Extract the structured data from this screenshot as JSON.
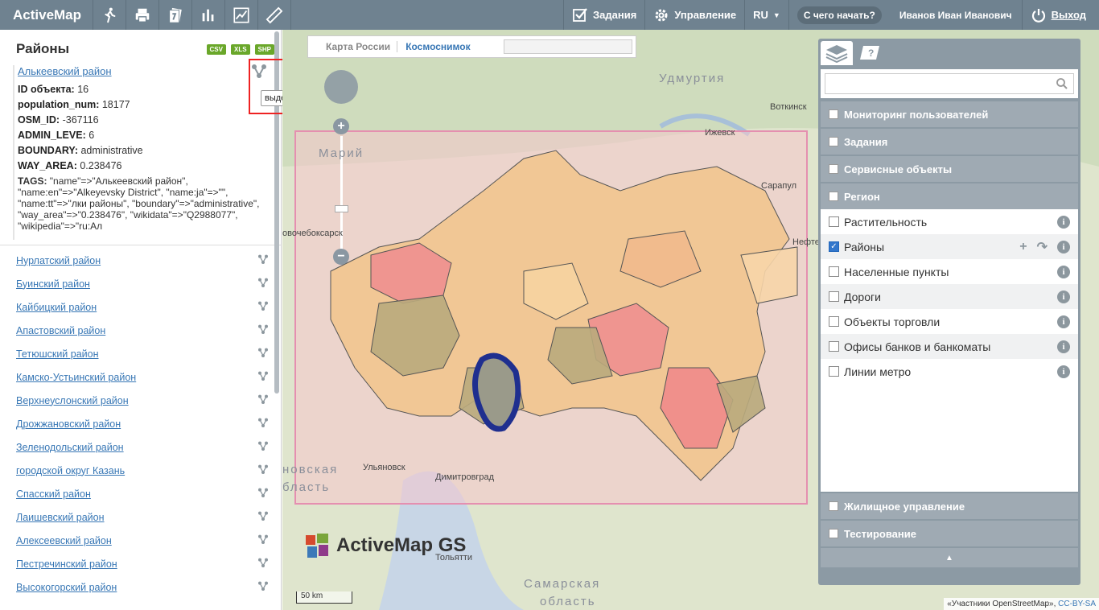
{
  "app": {
    "title": "ActiveMap"
  },
  "toolbar": {
    "icons": [
      "walk-icon",
      "print-icon",
      "document-icon",
      "bar-chart-icon",
      "line-chart-icon",
      "ruler-icon"
    ],
    "tasks_label": "Задания",
    "manage_label": "Управление",
    "lang_label": "RU",
    "help_label": "С чего начать?",
    "user_name": "Иванов Иван Иванович",
    "logout_label": "Выход"
  },
  "left": {
    "title": "Районы",
    "exports": [
      "CSV",
      "XLS",
      "SHP"
    ],
    "selected": {
      "name": "Алькеевский район",
      "fields": [
        {
          "k": "ID объекта:",
          "v": "16"
        },
        {
          "k": "population_num:",
          "v": "18177"
        },
        {
          "k": "OSM_ID:",
          "v": "-367116"
        },
        {
          "k": "ADMIN_LEVE:",
          "v": "6"
        },
        {
          "k": "BOUNDARY:",
          "v": "administrative"
        },
        {
          "k": "WAY_AREA:",
          "v": "0.238476"
        }
      ],
      "tags_label": "TAGS:",
      "tags": "\"name\"=>\"Алькеевский район\", \"name:en\"=>\"Alkeyevsky District\", \"name:ja\"=>\"\", \"name:tt\"=>\"лки районы\", \"boundary\"=>\"administrative\", \"way_area\"=>\"0.238476\", \"wikidata\"=>\"Q2988077\", \"wikipedia\"=>\"ru:Ал"
    },
    "tooltip": "выделить объект",
    "districts": [
      "Нурлатский район",
      "Буинский район",
      "Кайбицкий район",
      "Апастовский район",
      "Тетюшский район",
      "Камско-Устьинский район",
      "Верхнеуслонский район",
      "Дрожжановский район",
      "Зеленодольский район",
      "городской округ Казань",
      "Спасский район",
      "Лаишевский район",
      "Алексеевский район",
      "Пестречинский район",
      "Высокогорский район"
    ]
  },
  "map": {
    "tab_russia": "Карта России",
    "tab_satellite": "Космоснимок",
    "scale": "50 km",
    "attribution_prefix": "«Участники OpenStreetMap», ",
    "attribution_link": "CC-BY-SA",
    "logo_text": "ActiveMap GS",
    "labels": [
      "Удмуртия",
      "Воткинск",
      "Ижевск",
      "Сарапул",
      "Нефтека",
      "Марий",
      "овочебоксарск",
      "Ульяновск",
      "Димитровград",
      "Тольятти",
      "Самарская",
      "область",
      "новская",
      "бласть"
    ]
  },
  "right": {
    "groups_top": [
      "Мониторинг пользователей",
      "Задания",
      "Сервисные объекты",
      "Регион"
    ],
    "layers": [
      {
        "label": "Растительность",
        "checked": false
      },
      {
        "label": "Районы",
        "checked": true
      },
      {
        "label": "Населенные пункты",
        "checked": false
      },
      {
        "label": "Дороги",
        "checked": false
      },
      {
        "label": "Объекты торговли",
        "checked": false
      },
      {
        "label": "Офисы банков и банкоматы",
        "checked": false
      },
      {
        "label": "Линии метро",
        "checked": false
      }
    ],
    "groups_bottom": [
      "Жилищное управление",
      "Тестирование"
    ],
    "colors": {
      "panel": "#8c9aa4",
      "group": "#9faab3",
      "checkbox_on": "#3377cc"
    }
  },
  "colors": {
    "topbar": "#6f8290",
    "link": "#3877b5",
    "selection": "#1f2f8f",
    "bbox": "#e58fb0"
  }
}
